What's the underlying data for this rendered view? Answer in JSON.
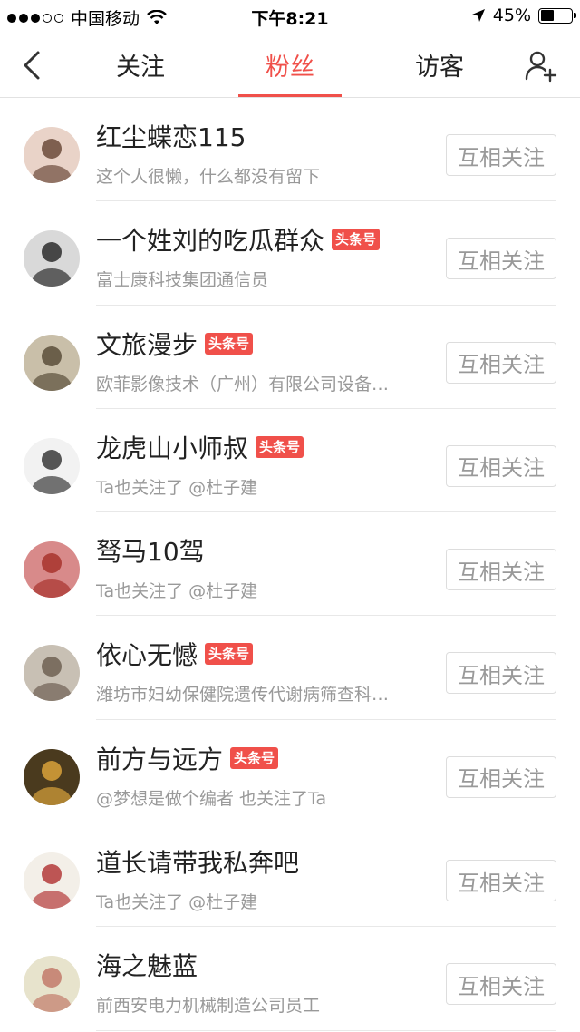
{
  "status_bar": {
    "carrier": "中国移动",
    "time": "下午8:21",
    "battery_percent": "45%",
    "battery_level": 0.45,
    "signal_bars": 3,
    "icons": [
      "wifi-icon",
      "location-arrow-icon",
      "battery-icon"
    ]
  },
  "nav": {
    "back_icon": "chevron-left-icon",
    "tabs": [
      {
        "label": "关注",
        "active": false
      },
      {
        "label": "粉丝",
        "active": true
      },
      {
        "label": "访客",
        "active": false
      }
    ],
    "add_friend_icon": "add-user-icon",
    "accent_color": "#f0504a"
  },
  "fans": [
    {
      "name": "红尘蝶恋115",
      "badge": "",
      "desc": "这个人很懒，什么都没有留下",
      "button": "互相关注"
    },
    {
      "name": "一个姓刘的吃瓜群众",
      "badge": "头条号",
      "desc": "富士康科技集团通信员",
      "button": "互相关注"
    },
    {
      "name": "文旅漫步",
      "badge": "头条号",
      "desc": "欧菲影像技术（广州）有限公司设备…",
      "button": "互相关注"
    },
    {
      "name": "龙虎山小师叔",
      "badge": "头条号",
      "desc": "Ta也关注了 @杜子建",
      "button": "互相关注"
    },
    {
      "name": "驽马10驾",
      "badge": "",
      "desc": "Ta也关注了 @杜子建",
      "button": "互相关注"
    },
    {
      "name": "依心无憾",
      "badge": "头条号",
      "desc": "潍坊市妇幼保健院遗传代谢病筛查科…",
      "button": "互相关注"
    },
    {
      "name": "前方与远方",
      "badge": "头条号",
      "desc": "@梦想是做个编者 也关注了Ta",
      "button": "互相关注"
    },
    {
      "name": "道长请带我私奔吧",
      "badge": "",
      "desc": "Ta也关注了 @杜子建",
      "button": "互相关注"
    },
    {
      "name": "海之魅蓝",
      "badge": "",
      "desc": "前西安电力机械制造公司员工",
      "button": "互相关注"
    }
  ]
}
